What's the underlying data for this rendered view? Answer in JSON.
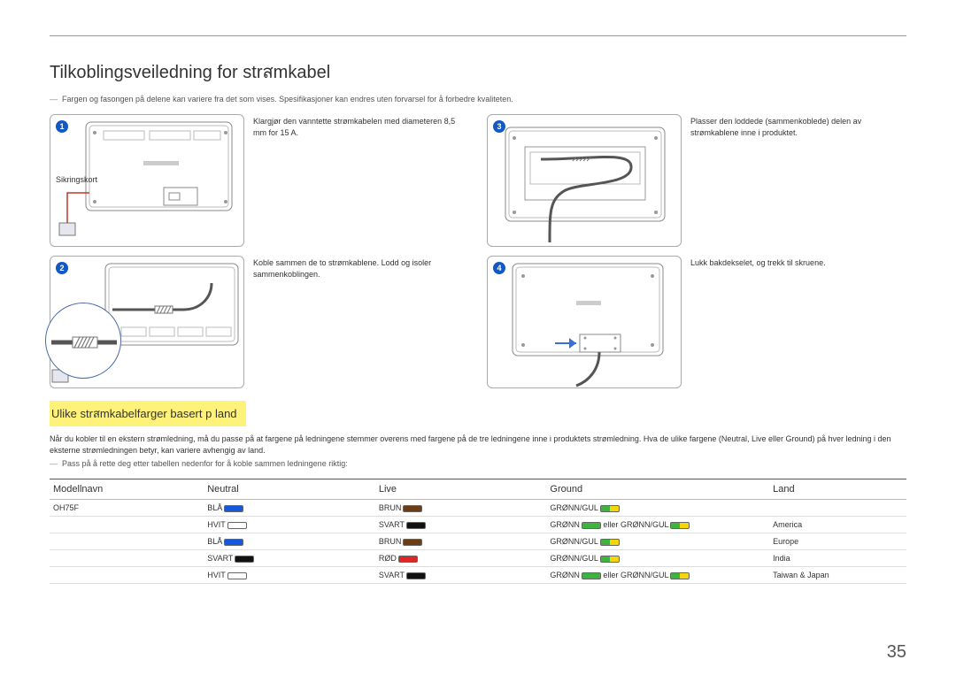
{
  "page": {
    "title": "Tilkoblingsveiledning for strสmkabel",
    "topnote": "Fargen og fasongen på delene kan variere fra det som vises. Spesifikasjoner kan endres uten forvarsel for å forbedre kvaliteten.",
    "page_number": "35"
  },
  "steps": {
    "s1": {
      "num": "1",
      "text": "Klargjør den vanntette strømkabelen med diameteren 8,5 mm for 15 A.",
      "label": "Sikringskort"
    },
    "s2": {
      "num": "2",
      "text": "Koble sammen de to strømkablene. Lodd og isoler sammenkoblingen."
    },
    "s3": {
      "num": "3",
      "text": "Plasser den loddede (sammenkoblede) delen av strømkablene inne i produktet."
    },
    "s4": {
      "num": "4",
      "text": "Lukk bakdekselet, og trekk til skruene."
    }
  },
  "section2": {
    "heading": "Ulike strสmkabelfarger basert p  land",
    "intro": "Når du kobler til en ekstern strømledning, må du passe på at fargene på ledningene stemmer overens med fargene på de tre ledningene inne i produktets strømledning. Hva de ulike fargene (Neutral, Live eller Ground) på hver ledning i den eksterne strømledningen betyr, kan variere avhengig av land.",
    "note": "Pass på å rette deg etter tabellen nedenfor for å koble sammen ledningene riktig:"
  },
  "table": {
    "headers": {
      "model": "Modellnavn",
      "neutral": "Neutral",
      "live": "Live",
      "ground": "Ground",
      "land": "Land"
    },
    "model": "OH75F",
    "text": {
      "BLA": "BLÅ",
      "BRUN": "BRUN",
      "GG": "GRØNN/GUL",
      "HVIT": "HVIT",
      "SVART": "SVART",
      "ROD": "RØD",
      "GRONN": "GRØNN",
      "eller": " eller "
    },
    "lands": {
      "r2": "America",
      "r3": "Europe",
      "r4": "India",
      "r5": "Taiwan & Japan"
    }
  }
}
